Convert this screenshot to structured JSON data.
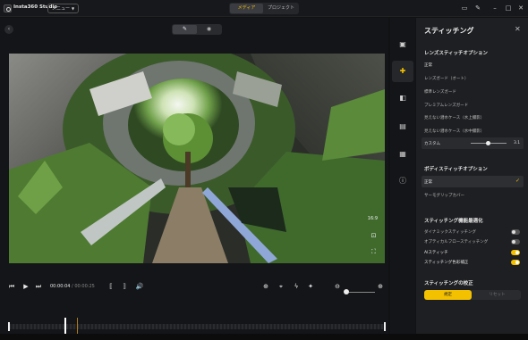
{
  "app": {
    "title": "Insta360 Studio",
    "menu_label": "メニュー"
  },
  "top_tabs": [
    {
      "label": "メディア",
      "active": true
    },
    {
      "label": "プロジェクト",
      "active": false
    }
  ],
  "window_icons": [
    "layout-icon",
    "edit-icon",
    "minimize-icon",
    "maximize-icon",
    "close-icon"
  ],
  "preview": {
    "aspect_ratio": "16:9",
    "view_modes": [
      "edit-icon",
      "eye-icon"
    ]
  },
  "playback": {
    "current_time": "00:00:04",
    "separator": " / ",
    "duration": "00:00:25"
  },
  "panel": {
    "title": "スティッチング",
    "lens_section": "レンズスティッチオプション",
    "lens_options": [
      "正常",
      "レンズガード（オート）",
      "標準レンズガード",
      "プレミアムレンズガード",
      "見えない潜水ケース（水上撮影）",
      "見えない潜水ケース（水中撮影）"
    ],
    "custom": {
      "label": "カスタム",
      "value": "3.1",
      "level": 0.55
    },
    "body_section": "ボディスティッチオプション",
    "body_options": [
      {
        "label": "正常",
        "selected": true
      },
      {
        "label": "サーモグリップカバー",
        "selected": false
      }
    ],
    "opt_section": "スティッチング機能最適化",
    "toggles": [
      {
        "label": "ダイナミックスティッチング",
        "on": false
      },
      {
        "label": "オプティカルフロースティッチング",
        "on": false
      },
      {
        "label": "AIスティッチ",
        "on": true
      },
      {
        "label": "スティッチング色彩補正",
        "on": true
      }
    ],
    "calib_section": "スティッチングの校正",
    "calib_buttons": {
      "primary": "規定",
      "secondary": "リセット"
    }
  },
  "colors": {
    "accent": "#f3c100",
    "panel_bg": "#1e1f22",
    "app_bg": "#111214"
  }
}
